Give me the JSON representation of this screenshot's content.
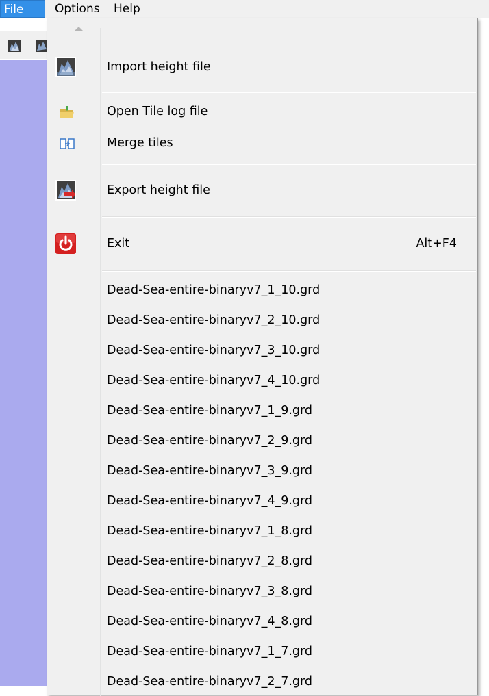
{
  "menubar": {
    "items": [
      {
        "label": "File",
        "mnemonic": "F",
        "rest": "ile",
        "active": true
      },
      {
        "label": "Options"
      },
      {
        "label": "Help"
      }
    ]
  },
  "toolbar": {
    "icons": [
      "height-map-icon",
      "height-map-export-icon"
    ]
  },
  "file_menu": {
    "import_height_file": "Import height file",
    "open_tile_log_file": "Open Tile log file",
    "merge_tiles": "Merge tiles",
    "export_height_file": "Export height file",
    "exit": "Exit",
    "exit_shortcut": "Alt+F4",
    "recent_files": [
      "Dead-Sea-entire-binaryv7_1_10.grd",
      "Dead-Sea-entire-binaryv7_2_10.grd",
      "Dead-Sea-entire-binaryv7_3_10.grd",
      "Dead-Sea-entire-binaryv7_4_10.grd",
      "Dead-Sea-entire-binaryv7_1_9.grd",
      "Dead-Sea-entire-binaryv7_2_9.grd",
      "Dead-Sea-entire-binaryv7_3_9.grd",
      "Dead-Sea-entire-binaryv7_4_9.grd",
      "Dead-Sea-entire-binaryv7_1_8.grd",
      "Dead-Sea-entire-binaryv7_2_8.grd",
      "Dead-Sea-entire-binaryv7_3_8.grd",
      "Dead-Sea-entire-binaryv7_4_8.grd",
      "Dead-Sea-entire-binaryv7_1_7.grd",
      "Dead-Sea-entire-binaryv7_2_7.grd"
    ]
  },
  "colors": {
    "menubar_active": "#3390e8",
    "menu_background": "#f0f0f0",
    "workspace_background": "#aaaaee",
    "exit_icon_red": "#d42020"
  }
}
